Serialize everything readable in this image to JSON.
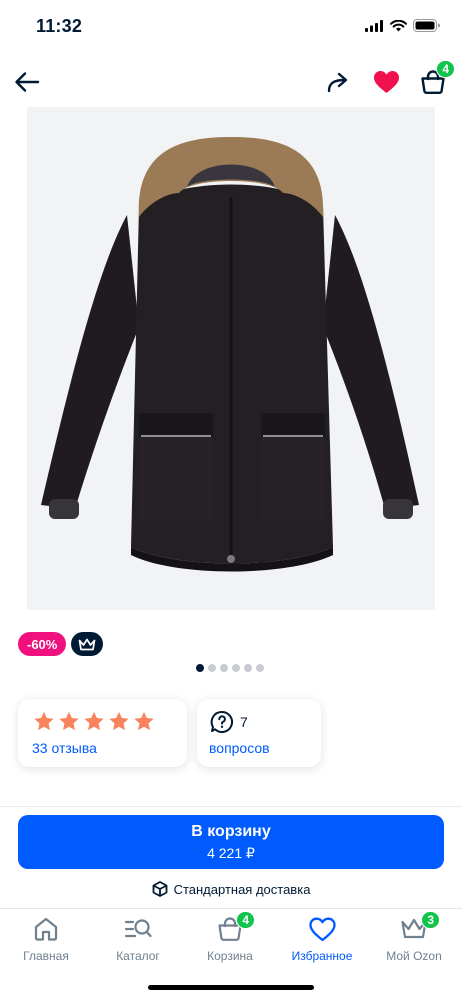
{
  "status_bar": {
    "time": "11:32",
    "icons": [
      "cellular-signal-icon",
      "wifi-icon",
      "battery-icon"
    ]
  },
  "top_nav": {
    "back_icon": "arrow-left-icon",
    "share_icon": "share-arrow-icon",
    "favorite_icon": "heart-icon",
    "favorite_color": "#f1114f",
    "cart_icon": "shopping-bag-icon",
    "cart_badge": "4"
  },
  "product": {
    "image": "black-winter-parka-with-fur-hood",
    "discount_badge": "-60%",
    "premium_icon": "crown-icon",
    "gallery_images": 6,
    "gallery_active_index": 0
  },
  "reviews": {
    "rating": 5,
    "max_rating": 5,
    "label": "33 отзыва",
    "star_color": "#f9835c"
  },
  "questions": {
    "icon": "question-bubble-icon",
    "count": "7",
    "label": "вопросов"
  },
  "add_to_cart": {
    "label": "В корзину",
    "price": "4 221 ₽"
  },
  "delivery": {
    "icon": "box-icon",
    "label": "Стандартная доставка"
  },
  "tab_bar": {
    "items": [
      {
        "label": "Главная",
        "icon": "home-icon",
        "active": false
      },
      {
        "label": "Каталог",
        "icon": "catalog-search-icon",
        "active": false
      },
      {
        "label": "Корзина",
        "icon": "shopping-bag-icon",
        "active": false,
        "badge": "4"
      },
      {
        "label": "Избранное",
        "icon": "heart-icon",
        "active": true
      },
      {
        "label": "Мой Ozon",
        "icon": "crown-icon",
        "active": false,
        "badge": "3"
      }
    ]
  },
  "colors": {
    "accent_blue": "#005bff",
    "discount_pink": "#f1117e",
    "badge_green": "#10c44c",
    "text_dark": "#001a34"
  }
}
